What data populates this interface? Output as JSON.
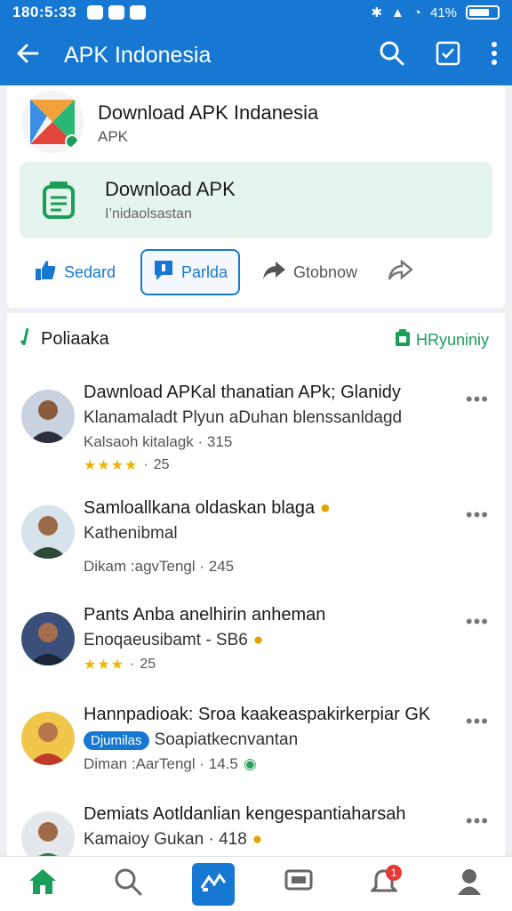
{
  "status": {
    "time": "180:5:33",
    "battery_text": "41%"
  },
  "appbar": {
    "title": "APK Indonesia"
  },
  "app_card": {
    "name": "Download APK Indanesia",
    "sub": "APK",
    "download_box": {
      "title": "Download APK",
      "subtitle": "I’nidaolsastan"
    },
    "actions": [
      {
        "label": "Sedard"
      },
      {
        "label": "Parlda"
      },
      {
        "label": "Gtobnow"
      }
    ]
  },
  "section": {
    "title": "Poliaaka",
    "right_label": "HRyuniniy"
  },
  "items": [
    {
      "line1": "Dawnload APKal thanatian APk; Glanidy",
      "line2": "Klanamaladt Plyun aDuhan blenssanldagd",
      "line3": "Kalsaoh kitalagk · 315",
      "rating": "★★★★",
      "count": "25"
    },
    {
      "line1": "Samloallkana oldaskan blaga",
      "line2": "Kathenibmal",
      "line3": "Dikam :agvTengl · 245"
    },
    {
      "line1": "Pants Anba anelhirin anheman",
      "line2": "Enoqaeusibamt - SB6",
      "rating": "★★★",
      "count": "25"
    },
    {
      "line1": "Hannpadioak: Sroa kaakeaspakirkerpiar GK",
      "chip": "Djumilas",
      "line2": "Soapiatkecnvantan",
      "line3": "Diman :AarTengl · 14.5"
    },
    {
      "line1": "Demiats Aotldanlian kengespantiaharsah",
      "line2": "Kamaioy Gukan · 418"
    }
  ],
  "bottom_nav": {
    "badge": "1"
  },
  "colors": {
    "primary": "#1678d2",
    "green": "#1b9e5a",
    "star": "#f2b400"
  }
}
